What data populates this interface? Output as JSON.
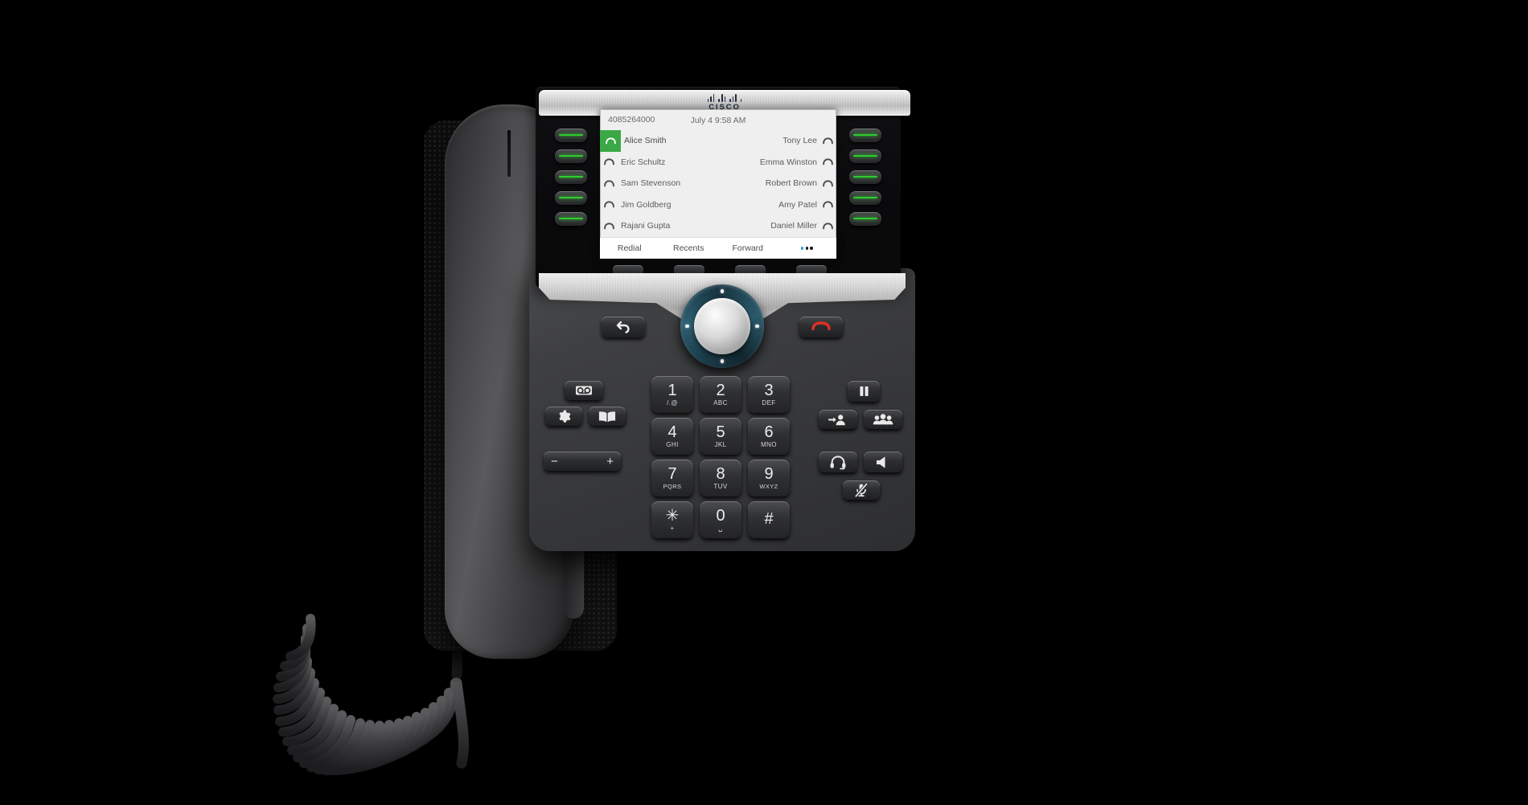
{
  "device": {
    "brand": "CISCO",
    "accent_green": "#3aa845",
    "led_green": "#2ecc2e",
    "accent_blue": "#2a9fd8",
    "release_red": "#e03024"
  },
  "screen": {
    "header": {
      "line_number": "4085264000",
      "datetime": "July 4 9:58 AM"
    },
    "lines": [
      {
        "left_label": "Alice Smith",
        "right_label": "Tony Lee",
        "left_icon": "handset-icon",
        "right_icon": "handset-icon",
        "active": true
      },
      {
        "left_label": "Eric Schultz",
        "right_label": "Emma Winston",
        "left_icon": "handset-icon",
        "right_icon": "handset-icon",
        "active": false
      },
      {
        "left_label": "Sam Stevenson",
        "right_label": "Robert Brown",
        "left_icon": "handset-icon",
        "right_icon": "handset-icon",
        "active": false
      },
      {
        "left_label": "Jim Goldberg",
        "right_label": "Amy Patel",
        "left_icon": "handset-icon",
        "right_icon": "handset-icon",
        "active": false
      },
      {
        "left_label": "Rajani Gupta",
        "right_label": "Daniel Miller",
        "left_icon": "handset-icon",
        "right_icon": "handset-icon",
        "active": false
      }
    ],
    "softkeys": [
      {
        "label": "Redial"
      },
      {
        "label": "Recents"
      },
      {
        "label": "Forward"
      },
      {
        "label": "",
        "icon": "more-dots-icon"
      }
    ]
  },
  "line_keys": {
    "left_count": 5,
    "right_count": 5,
    "state": "lit-green"
  },
  "keypad": [
    {
      "digit": "1",
      "letters": "/.@"
    },
    {
      "digit": "2",
      "letters": "ABC"
    },
    {
      "digit": "3",
      "letters": "DEF"
    },
    {
      "digit": "4",
      "letters": "GHI"
    },
    {
      "digit": "5",
      "letters": "JKL"
    },
    {
      "digit": "6",
      "letters": "MNO"
    },
    {
      "digit": "7",
      "letters": "PQRS"
    },
    {
      "digit": "8",
      "letters": "TUV"
    },
    {
      "digit": "9",
      "letters": "WXYZ"
    },
    {
      "digit": "✳",
      "letters": "+"
    },
    {
      "digit": "0",
      "letters": "␣"
    },
    {
      "digit": "#",
      "letters": ""
    }
  ],
  "feature_buttons": {
    "voicemail": {
      "icon": "voicemail-icon"
    },
    "settings": {
      "icon": "gear-icon"
    },
    "directory": {
      "icon": "book-icon"
    },
    "volume_down": {
      "icon": "minus-icon",
      "glyph": "−"
    },
    "volume_up": {
      "icon": "plus-icon",
      "glyph": "+"
    },
    "hold": {
      "icon": "pause-icon"
    },
    "transfer": {
      "icon": "transfer-person-icon"
    },
    "conference": {
      "icon": "conference-group-icon"
    },
    "headset": {
      "icon": "headset-icon"
    },
    "speakerphone": {
      "icon": "speaker-icon"
    },
    "mute": {
      "icon": "mute-microphone-icon"
    },
    "back": {
      "icon": "back-arrow-icon"
    },
    "release": {
      "icon": "end-call-handset-icon"
    },
    "navigation": {
      "icon": "navigation-ring-icon"
    },
    "select": {
      "icon": "select-button-icon"
    }
  },
  "hardware": {
    "handset": "handset",
    "cradle": "handset-cradle",
    "cord": "coiled-cord",
    "softkey_count": 4
  }
}
